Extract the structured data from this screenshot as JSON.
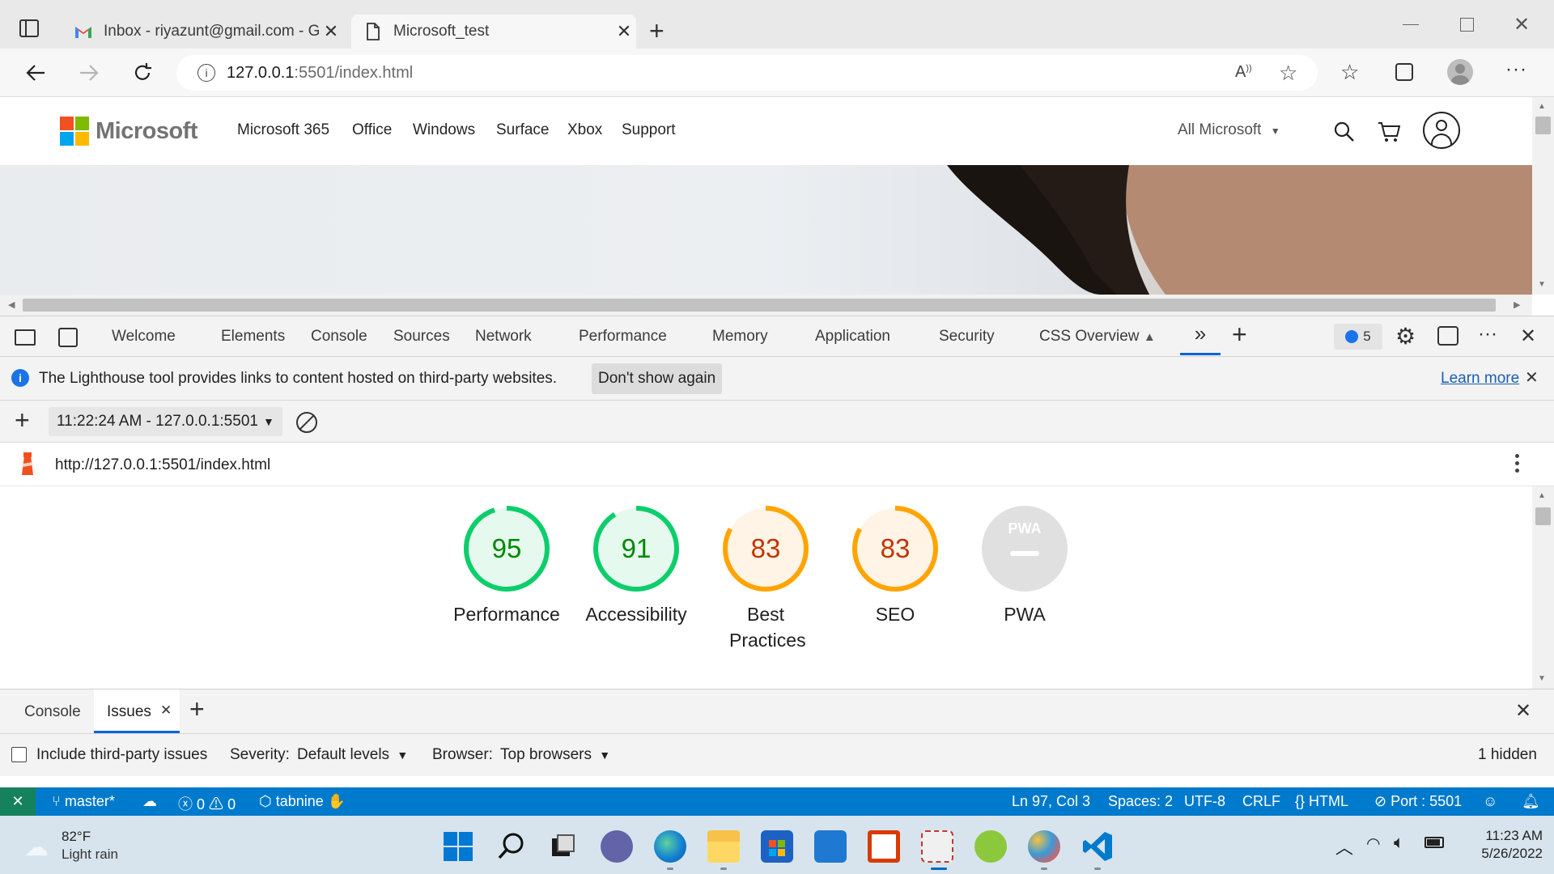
{
  "browser": {
    "tabs": [
      {
        "title": "Inbox - riyazunt@gmail.com - Gmail",
        "active": false
      },
      {
        "title": "Microsoft_test",
        "active": true
      }
    ],
    "url_host": "127.0.0.1",
    "url_rest": ":5501/index.html"
  },
  "site": {
    "brand": "Microsoft",
    "nav": [
      "Microsoft 365",
      "Office",
      "Windows",
      "Surface",
      "Xbox",
      "Support"
    ],
    "all_microsoft": "All Microsoft"
  },
  "devtools": {
    "tabs": [
      "Welcome",
      "Elements",
      "Console",
      "Sources",
      "Network",
      "Performance",
      "Memory",
      "Application",
      "Security",
      "CSS Overview"
    ],
    "issues_count": "5",
    "info_message": "The Lighthouse tool provides links to content hosted on third-party websites.",
    "dont_show_label": "Don't show again",
    "learn_more_label": "Learn more",
    "report_select": "11:22:24 AM - 127.0.0.1:5501",
    "report_url": "http://127.0.0.1:5501/index.html",
    "scores": [
      {
        "value": "95",
        "label": "Performance",
        "score": 95,
        "color": "#0cce6b",
        "text_color": "#008800",
        "bg": "#e6f9ee"
      },
      {
        "value": "91",
        "label": "Accessibility",
        "score": 91,
        "color": "#0cce6b",
        "text_color": "#008800",
        "bg": "#e6f9ee"
      },
      {
        "value": "83",
        "label": "Best Practices",
        "score": 83,
        "color": "#ffa400",
        "text_color": "#c33300",
        "bg": "#fff4e5"
      },
      {
        "value": "83",
        "label": "SEO",
        "score": 83,
        "color": "#ffa400",
        "text_color": "#c33300",
        "bg": "#fff4e5"
      }
    ],
    "pwa": {
      "badge": "PWA",
      "label": "PWA"
    },
    "drawer": {
      "tabs": [
        "Console",
        "Issues"
      ],
      "include_third_party": "Include third-party issues",
      "severity_label": "Severity:",
      "severity_value": "Default levels",
      "browser_label": "Browser:",
      "browser_value": "Top browsers",
      "hidden_count": "1 hidden"
    }
  },
  "vscode_status": {
    "branch": "master*",
    "errors": "0",
    "warnings": "0",
    "tabnine": "tabnine",
    "position": "Ln 97, Col 3",
    "spaces": "Spaces: 2",
    "encoding": "UTF-8",
    "eol": "CRLF",
    "language": "HTML",
    "port": "Port : 5501"
  },
  "taskbar": {
    "temperature": "82°F",
    "weather": "Light rain",
    "time": "11:23 AM",
    "date": "5/26/2022"
  },
  "colors": {
    "accent": "#007acc",
    "good": "#0cce6b",
    "average": "#ffa400",
    "gray": "#e0e0e0"
  }
}
